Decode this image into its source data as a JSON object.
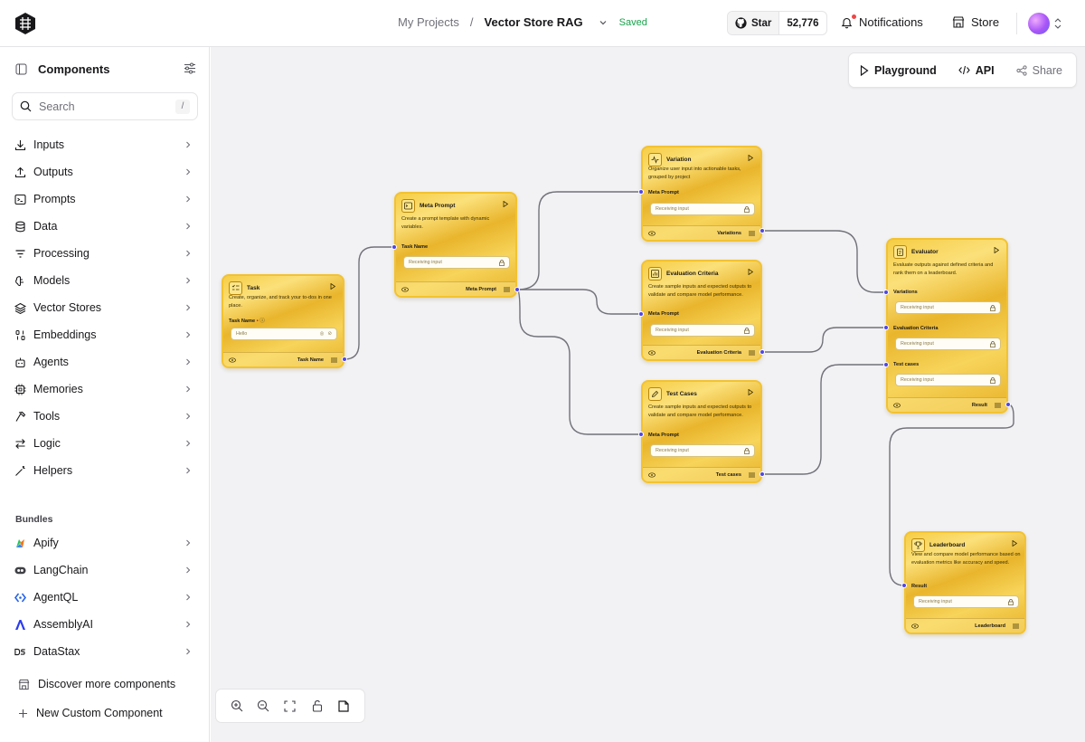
{
  "header": {
    "breadcrumb_root": "My Projects",
    "breadcrumb_sep": "/",
    "project_name": "Vector Store RAG",
    "save_status": "Saved",
    "star_label": "Star",
    "star_count": "52,776",
    "notifications_label": "Notifications",
    "store_label": "Store"
  },
  "sidebar": {
    "title": "Components",
    "search_placeholder": "Search",
    "search_shortcut": "/",
    "categories": [
      {
        "label": "Inputs",
        "icon": "download-icon"
      },
      {
        "label": "Outputs",
        "icon": "upload-icon"
      },
      {
        "label": "Prompts",
        "icon": "terminal-icon"
      },
      {
        "label": "Data",
        "icon": "database-icon"
      },
      {
        "label": "Processing",
        "icon": "filter-icon"
      },
      {
        "label": "Models",
        "icon": "brain-icon"
      },
      {
        "label": "Vector Stores",
        "icon": "layers-icon"
      },
      {
        "label": "Embeddings",
        "icon": "binary-icon"
      },
      {
        "label": "Agents",
        "icon": "bot-icon"
      },
      {
        "label": "Memories",
        "icon": "cpu-icon"
      },
      {
        "label": "Tools",
        "icon": "hammer-icon"
      },
      {
        "label": "Logic",
        "icon": "arrows-icon"
      },
      {
        "label": "Helpers",
        "icon": "wand-icon"
      }
    ],
    "bundles_label": "Bundles",
    "bundles": [
      {
        "label": "Apify",
        "icon": "apify-icon"
      },
      {
        "label": "LangChain",
        "icon": "langchain-icon"
      },
      {
        "label": "AgentQL",
        "icon": "agentql-icon"
      },
      {
        "label": "AssemblyAI",
        "icon": "assemblyai-icon"
      },
      {
        "label": "DataStax",
        "icon": "datastax-icon"
      }
    ],
    "discover_label": "Discover more components",
    "new_custom_label": "New Custom Component"
  },
  "toolbar": {
    "playground_label": "Playground",
    "api_label": "API",
    "share_label": "Share"
  },
  "nodes": {
    "task": {
      "title": "Task",
      "desc": "Create, organize, and track your to-dos in one place.",
      "field_label": "Task Name",
      "field_value": "Hello",
      "output": "Task Name"
    },
    "meta_prompt": {
      "title": "Meta Prompt",
      "desc": "Create a prompt template with dynamic variables.",
      "field_label": "Task Name",
      "field_placeholder": "Receiving input",
      "output": "Meta Prompt"
    },
    "variation": {
      "title": "Variation",
      "desc": "Organize user input into actionable tasks, grouped by project",
      "field_label": "Meta Prompt",
      "field_placeholder": "Receiving input",
      "output": "Variations"
    },
    "evaluation_criteria": {
      "title": "Evaluation Criteria",
      "desc": "Create sample inputs and expected outputs to validate and compare model performance.",
      "field_label": "Meta Prompt",
      "field_placeholder": "Receiving input",
      "output": "Evaluation Criteria"
    },
    "test_cases": {
      "title": "Test Cases",
      "desc": "Create sample inputs and expected outputs to validate and compare model performance.",
      "field_label": "Meta Prompt",
      "field_placeholder": "Receiving input",
      "output": "Test cases"
    },
    "evaluator": {
      "title": "Evaluator",
      "desc": "Evaluate outputs against defined criteria and rank them on a leaderboard.",
      "field1_label": "Variations",
      "field2_label": "Evaluation Criteria",
      "field3_label": "Test cases",
      "field_placeholder": "Receiving input",
      "output": "Result"
    },
    "leaderboard": {
      "title": "Leaderboard",
      "desc": "View and compare model performance based on evaluation metrics like accuracy and speed.",
      "field_label": "Result",
      "field_placeholder": "Receiving input",
      "output": "Leaderboard"
    }
  }
}
